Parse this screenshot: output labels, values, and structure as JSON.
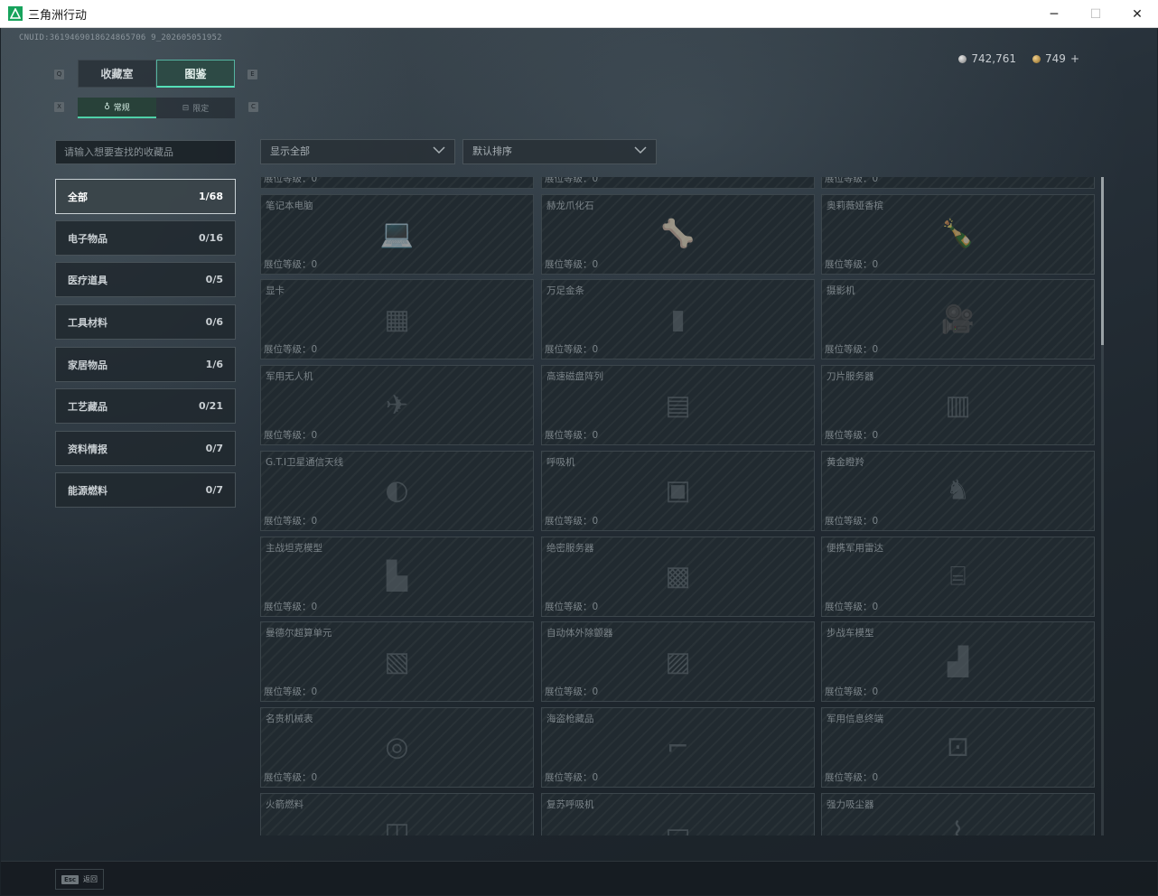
{
  "window": {
    "title": "三角洲行动",
    "minimize": "─",
    "maximize": "☐",
    "close": "✕"
  },
  "uid": "CNUID:3619469018624865706 9_202605051952",
  "currency": {
    "silver": "742,761",
    "gold": "749",
    "add": "+"
  },
  "keys": {
    "q": "Q",
    "e": "E",
    "x": "X",
    "c": "C"
  },
  "main_tabs": [
    {
      "label": "收藏室"
    },
    {
      "label": "图鉴"
    }
  ],
  "sub_tabs": [
    {
      "label": "常规"
    },
    {
      "label": "限定"
    }
  ],
  "search": {
    "placeholder": "请输入想要查找的收藏品"
  },
  "filter": {
    "label": "显示全部"
  },
  "sort": {
    "label": "默认排序"
  },
  "categories": [
    {
      "label": "全部",
      "count": "1/68"
    },
    {
      "label": "电子物品",
      "count": "0/16"
    },
    {
      "label": "医疗道具",
      "count": "0/5"
    },
    {
      "label": "工具材料",
      "count": "0/6"
    },
    {
      "label": "家居物品",
      "count": "1/6"
    },
    {
      "label": "工艺藏品",
      "count": "0/21"
    },
    {
      "label": "资料情报",
      "count": "0/7"
    },
    {
      "label": "能源燃料",
      "count": "0/7"
    }
  ],
  "level_label": "展位等级：0",
  "items": [
    {
      "name": "",
      "icon": "partial-row"
    },
    {
      "name": "",
      "icon": "partial-row"
    },
    {
      "name": "",
      "icon": "partial-row"
    },
    {
      "name": "笔记本电脑",
      "icon": "laptop-icon"
    },
    {
      "name": "赫龙爪化石",
      "icon": "fossil-icon"
    },
    {
      "name": "奥莉薇娅香槟",
      "icon": "champagne-icon"
    },
    {
      "name": "显卡",
      "icon": "gpu-icon"
    },
    {
      "name": "万足金条",
      "icon": "gold-bar-icon"
    },
    {
      "name": "摄影机",
      "icon": "camera-icon"
    },
    {
      "name": "军用无人机",
      "icon": "drone-icon"
    },
    {
      "name": "高速磁盘阵列",
      "icon": "disk-array-icon"
    },
    {
      "name": "刀片服务器",
      "icon": "blade-server-icon"
    },
    {
      "name": "G.T.I卫星通信天线",
      "icon": "satellite-dish-icon"
    },
    {
      "name": "呼吸机",
      "icon": "ventilator-icon"
    },
    {
      "name": "黄金瞪羚",
      "icon": "gazelle-statue-icon"
    },
    {
      "name": "主战坦克模型",
      "icon": "tank-model-icon"
    },
    {
      "name": "绝密服务器",
      "icon": "secret-server-icon"
    },
    {
      "name": "便携军用雷达",
      "icon": "radar-icon"
    },
    {
      "name": "曼德尔超算单元",
      "icon": "supercomputer-icon"
    },
    {
      "name": "自动体外除颤器",
      "icon": "defibrillator-icon"
    },
    {
      "name": "步战车模型",
      "icon": "ifv-model-icon"
    },
    {
      "name": "名贵机械表",
      "icon": "watch-icon"
    },
    {
      "name": "海盗枪藏品",
      "icon": "pirate-gun-icon"
    },
    {
      "name": "军用信息终端",
      "icon": "terminal-icon"
    },
    {
      "name": "火箭燃料",
      "icon": "rocket-fuel-icon"
    },
    {
      "name": "复苏呼吸机",
      "icon": "resuscitator-icon"
    },
    {
      "name": "强力吸尘器",
      "icon": "vacuum-icon"
    }
  ],
  "bottom": {
    "esc_key": "Esc",
    "esc_label": "返回"
  }
}
